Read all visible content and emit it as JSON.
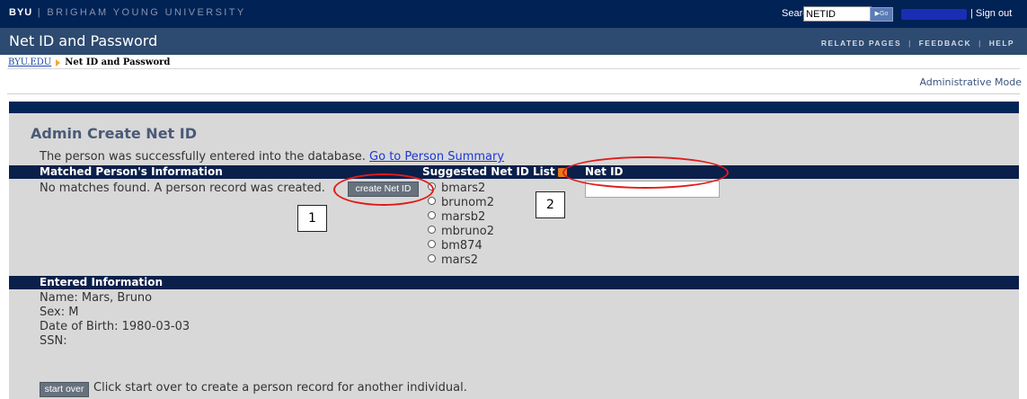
{
  "header": {
    "brand_bold": "BYU",
    "brand_rest": "| BRIGHAM YOUNG UNIVERSITY",
    "search_label": "Search",
    "search_value": "NETID",
    "go_label": "Go",
    "signout_label": "| Sign out"
  },
  "titlebar": {
    "title": "Net ID and Password",
    "links": [
      "RELATED PAGES",
      "FEEDBACK",
      "HELP"
    ]
  },
  "breadcrumb": {
    "home": "BYU.EDU",
    "current": "Net ID and Password"
  },
  "admin_mode_label": "Administrative Mode",
  "main": {
    "heading": "Admin Create Net ID",
    "success_text": "The person was successfully entered into the database.",
    "summary_link": "Go to Person Summary",
    "matched_header": "Matched Person's Information",
    "suggested_header": "Suggested Net ID List",
    "netid_header": "Net ID",
    "no_matches_text": "No matches found. A person record was created.",
    "create_button": "create Net ID",
    "netid_value": "",
    "suggestions": [
      "bmars2",
      "brunom2",
      "marsb2",
      "mbruno2",
      "bm874",
      "mars2"
    ],
    "entered_header": "Entered Information",
    "entered": {
      "name": "Name: Mars, Bruno",
      "sex": "Sex: M",
      "dob": "Date of Birth: 1980-03-03",
      "ssn": "SSN:"
    },
    "start_over_button": "start over",
    "start_over_text": "Click start over to create a person record for another individual."
  },
  "annotations": {
    "callout1": "1",
    "callout2": "2",
    "highlight_color": "#e21b1b"
  },
  "colors": {
    "header_navy": "#002255",
    "titlebar_blue": "#2d4a70",
    "section_bar": "#0a1f4a",
    "panel_gray": "#d8d8d8"
  }
}
